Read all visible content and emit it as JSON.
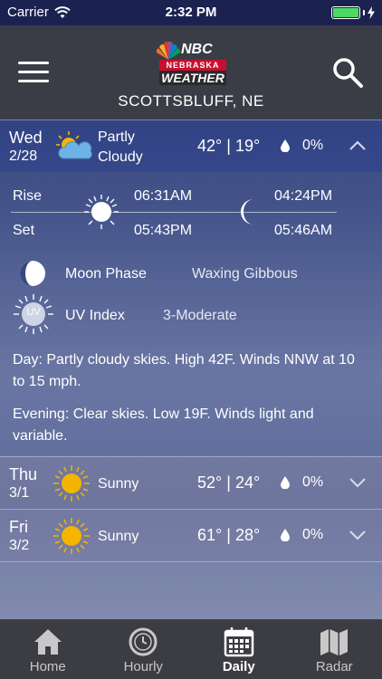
{
  "status_bar": {
    "carrier": "Carrier",
    "time": "2:32 PM"
  },
  "header": {
    "logo": {
      "network": "NBC",
      "state": "NEBRASKA",
      "brand": "WEATHER"
    },
    "location": "SCOTTSBLUFF, NE",
    "menu_icon": "hamburger-icon",
    "search_icon": "search-icon"
  },
  "days": [
    {
      "name": "Wed",
      "date": "2/28",
      "condition_line1": "Partly",
      "condition_line2": "Cloudy",
      "high": "42°",
      "low": "19°",
      "precip": "0%",
      "icon": "partly-cloudy-icon",
      "expanded": true
    },
    {
      "name": "Thu",
      "date": "3/1",
      "condition_line1": "Sunny",
      "high": "52°",
      "low": "24°",
      "precip": "0%",
      "icon": "sun-icon",
      "expanded": false
    },
    {
      "name": "Fri",
      "date": "3/2",
      "condition_line1": "Sunny",
      "high": "61°",
      "low": "28°",
      "precip": "0%",
      "icon": "sun-icon",
      "expanded": false
    }
  ],
  "details": {
    "rise_label": "Rise",
    "set_label": "Set",
    "sunrise": "06:31AM",
    "sunset": "05:43PM",
    "moonrise": "04:24PM",
    "moonset": "05:46AM",
    "moon_phase_label": "Moon Phase",
    "moon_phase_value": "Waxing Gibbous",
    "uv_label": "UV Index",
    "uv_icon_text": "UV",
    "uv_value": "3-Moderate",
    "day_label": "Day",
    "day_text": ": Partly cloudy skies. High 42F. Winds NNW at 10 to 15 mph.",
    "evening_label": "Evening",
    "evening_text": ": Clear skies. Low 19F. Winds light and variable."
  },
  "tabs": [
    {
      "label": "Home",
      "icon": "home-icon",
      "active": false
    },
    {
      "label": "Hourly",
      "icon": "clock-icon",
      "active": false
    },
    {
      "label": "Daily",
      "icon": "calendar-icon",
      "active": true
    },
    {
      "label": "Radar",
      "icon": "map-icon",
      "active": false
    }
  ],
  "colors": {
    "status_bar": "#1c2250",
    "header": "#3a3d46",
    "tabbar": "#3c3d43",
    "sun": "#f5b400",
    "battery": "#4cd964",
    "nbc_red": "#c8102e"
  }
}
